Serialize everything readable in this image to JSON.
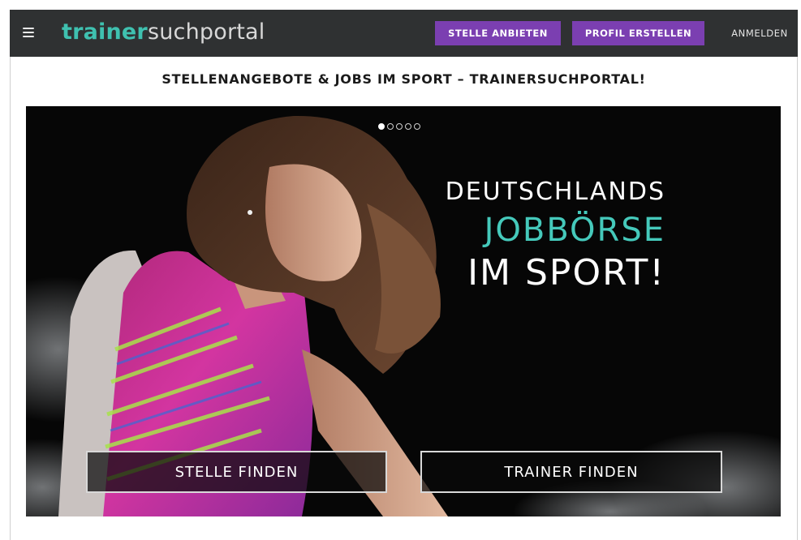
{
  "header": {
    "logo_part1": "trainer",
    "logo_part2": "suchportal",
    "post_job_label": "STELLE ANBIETEN",
    "create_profile_label": "PROFIL ERSTELLEN",
    "login_label": "ANMELDEN"
  },
  "page": {
    "headline": "STELLENANGEBOTE & JOBS IM SPORT – TRAINERSUCHPORTAL!"
  },
  "hero": {
    "line1": "DEUTSCHLANDS",
    "line2": "JOBBÖRSE",
    "line3": "IM SPORT!",
    "slide_count": 5,
    "active_slide": 1,
    "find_job_label": "STELLE FINDEN",
    "find_trainer_label": "TRAINER FINDEN"
  },
  "colors": {
    "topbar": "#2f3132",
    "accent_teal": "#45c9bb",
    "button_purple": "#7b3fb1"
  },
  "icons": {
    "menu": "hamburger-menu-icon"
  }
}
